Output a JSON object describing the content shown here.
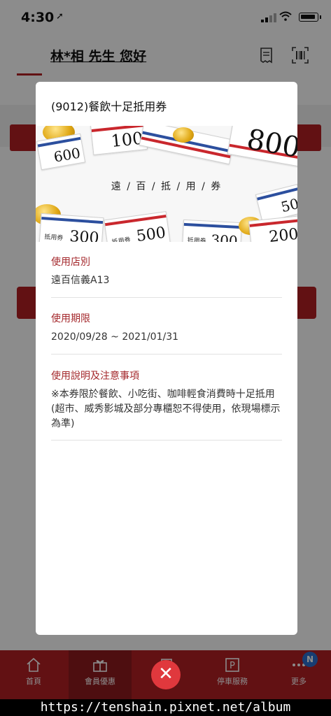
{
  "status_bar": {
    "time": "4:30"
  },
  "header": {
    "greeting": "林*相 先生 您好"
  },
  "bottom_nav": {
    "items": [
      {
        "label": "首頁"
      },
      {
        "label": "會員優惠"
      },
      {
        "label": ""
      },
      {
        "label": "停車服務"
      },
      {
        "label": "更多"
      }
    ],
    "badge": "N"
  },
  "modal": {
    "title": "(9012)餐飲十足抵用券",
    "banner": {
      "text": "遠 / 百 / 抵 / 用 / 券",
      "coupon_label": "抵用券",
      "coupons": [
        "100",
        "600",
        "800",
        "500",
        "300",
        "300",
        "200",
        "50",
        "800"
      ]
    },
    "sections": [
      {
        "label": "使用店別",
        "value": "遠百信義A13"
      },
      {
        "label": "使用期限",
        "value": "2020/09/28 ~ 2021/01/31"
      },
      {
        "label": "使用說明及注意事項",
        "value": "※本券限於餐飲、小吃街、咖啡輕食消費時十足抵用(超市、威秀影城及部分專櫃恕不得使用，依現場標示為準)"
      }
    ]
  },
  "close_symbol": "✕",
  "watermark": "https://tenshain.pixnet.net/album",
  "colors": {
    "accent": "#b21f24",
    "label": "#a4282c",
    "close": "#e0383d"
  }
}
